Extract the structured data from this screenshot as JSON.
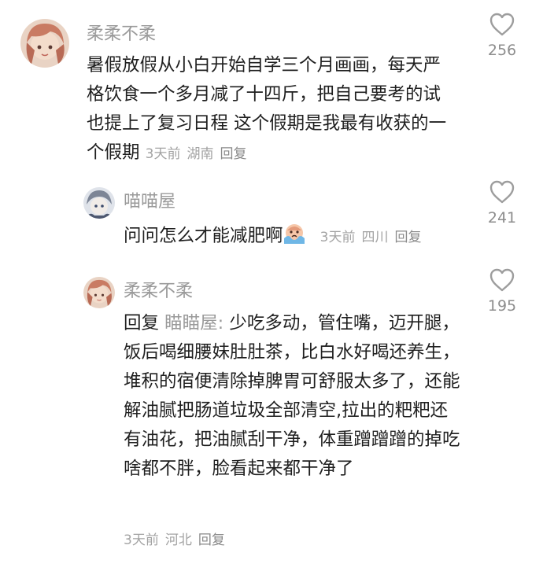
{
  "comments": [
    {
      "username": "柔柔不柔",
      "text": "暑假放假从小白开始自学三个月画画，每天严格饮食一个多月减了十四斤，把自己要考的试也提上了复习日程 这个假期是我最有收获的一个假期",
      "time": "3天前",
      "location": "湖南",
      "reply_label": "回复",
      "likes": "256",
      "avatar_icon": "anime-girl-avatar"
    },
    {
      "username": "喵喵屋",
      "text": "问问怎么才能减肥啊",
      "emoji": "crying-face-emoji",
      "time": "3天前",
      "location": "四川",
      "reply_label": "回复",
      "likes": "241",
      "avatar_icon": "anime-character-avatar"
    },
    {
      "username": "柔柔不柔",
      "reply_prefix": "回复",
      "reply_to": "瞄瞄屋:",
      "text": "少吃多动，管住嘴，迈开腿，饭后喝细腰妹肚肚茶，比白水好喝还养生，堆积的宿便清除掉脾胃可舒服太多了，还能解油腻把肠道垃圾全部清空,拉出的粑粑还有油花，把油腻刮干净，体重蹭蹭蹭的掉吃啥都不胖，脸看起来都干净了",
      "time": "3天前",
      "location": "河北",
      "reply_label": "回复",
      "likes": "195",
      "avatar_icon": "anime-girl-avatar"
    }
  ],
  "colors": {
    "text": "#1f1f1f",
    "muted": "#9a9a9a",
    "heart": "#9d9d9d"
  }
}
